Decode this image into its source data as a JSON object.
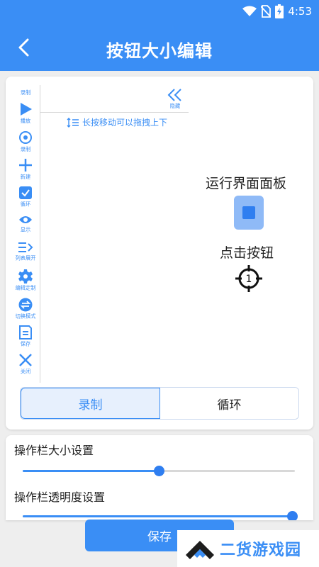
{
  "status_bar": {
    "time": "4:53",
    "icons": [
      "wifi-icon",
      "no-sim-icon",
      "battery-charging-icon"
    ]
  },
  "header": {
    "title": "按钮大小编辑",
    "back_icon": "chevron-left-icon"
  },
  "toolbar": {
    "items": [
      {
        "label": "录制",
        "icon": "none"
      },
      {
        "label": "播放",
        "icon": "play-icon"
      },
      {
        "label": "录制",
        "icon": "record-icon"
      },
      {
        "label": "新建",
        "icon": "plus-icon"
      },
      {
        "label": "循环",
        "icon": "checkbox-icon"
      },
      {
        "label": "显示",
        "icon": "eye-icon"
      },
      {
        "label": "列表展开",
        "icon": "list-expand-icon"
      },
      {
        "label": "编辑定制",
        "icon": "gear-icon"
      },
      {
        "label": "切换模式",
        "icon": "switch-icon"
      },
      {
        "label": "保存",
        "icon": "save-icon"
      },
      {
        "label": "关闭",
        "icon": "close-icon"
      }
    ],
    "collapse_label": "隐藏"
  },
  "hint": "长按移动可以拖拽上下",
  "panel": {
    "title": "运行界面面板",
    "click_label": "点击按钮",
    "target_number": "1"
  },
  "tabs": [
    {
      "label": "录制",
      "active": true
    },
    {
      "label": "循环",
      "active": false
    }
  ],
  "settings": {
    "size_label": "操作栏大小设置",
    "size_value": 0.5,
    "opacity_label": "操作栏透明度设置",
    "opacity_value": 0.99
  },
  "save_label": "保存",
  "watermark": "二货游戏园",
  "colors": {
    "primary": "#3a8ef5",
    "stop_button_bg": "#8fbaf7"
  }
}
